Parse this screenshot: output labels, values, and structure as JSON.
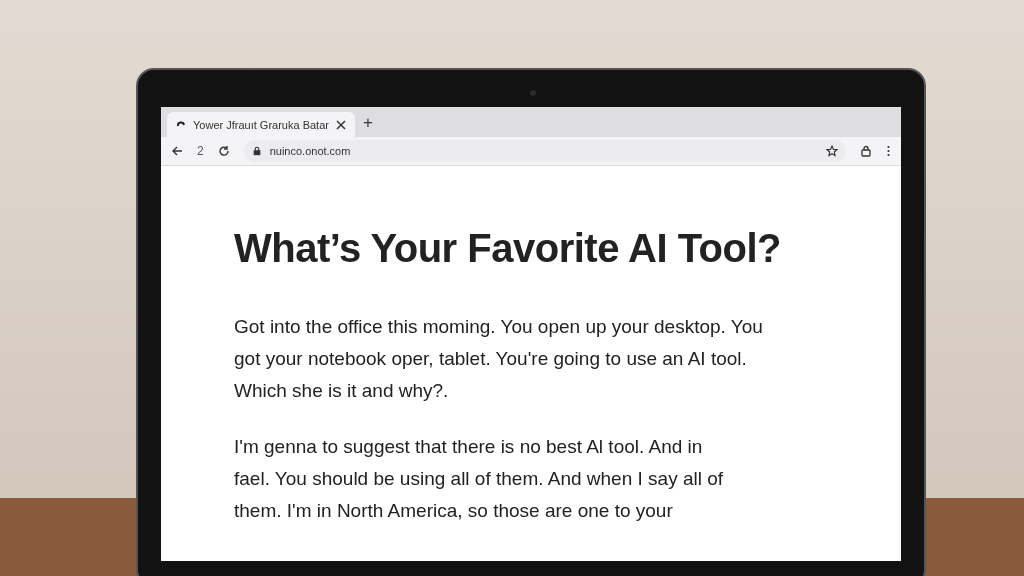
{
  "tabs": [
    {
      "title": "Yower Jfrauıt Graruka Batar",
      "selected": true
    }
  ],
  "new_tab": "+",
  "address_bar": {
    "nav_glyph": "2",
    "url": "nuinco.onot.com"
  },
  "article": {
    "title": "What’s Your Favorite AI Tool?",
    "paragraphs": [
      [
        "Got into the office this moming. You open up your desktop. You",
        "got your notebook oper, tablet. You're going to use an AI tool.",
        "Which she is it and why?."
      ],
      [
        "I'm genna to suggest that there is no best Al tool. And in",
        "fael. You should be using all of them. And when I say all of",
        "them. I'm in North America, so those are one to your"
      ]
    ]
  }
}
